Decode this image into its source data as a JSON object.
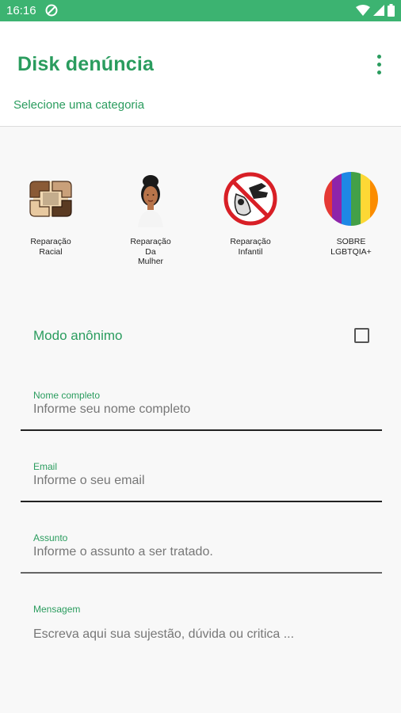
{
  "status_bar": {
    "time": "16:16"
  },
  "app_bar": {
    "title": "Disk denúncia",
    "subtitle": "Selecione uma categoria"
  },
  "categories": [
    {
      "label": "Reparação\nRacial",
      "icon": "joined-hands-icon"
    },
    {
      "label": "Reparação\nDa\nMulher",
      "icon": "woman-avatar-icon"
    },
    {
      "label": "Reparação\nInfantil",
      "icon": "child-protection-icon"
    },
    {
      "label": "SOBRE\nLGBTQIA+",
      "icon": "rainbow-flag-icon"
    }
  ],
  "anonymous": {
    "label": "Modo anônimo",
    "checked": false
  },
  "form": {
    "name": {
      "label": "Nome completo",
      "placeholder": "Informe seu nome completo"
    },
    "email": {
      "label": "Email",
      "placeholder": "Informe o seu email"
    },
    "subject": {
      "label": "Assunto",
      "placeholder": "Informe o assunto a ser tratado."
    },
    "message": {
      "label": "Mensagem",
      "placeholder": "Escreva aqui sua sujestão, dúvida ou critica ..."
    }
  },
  "colors": {
    "accent": "#2a9c5e",
    "status_bar": "#3cb371"
  }
}
